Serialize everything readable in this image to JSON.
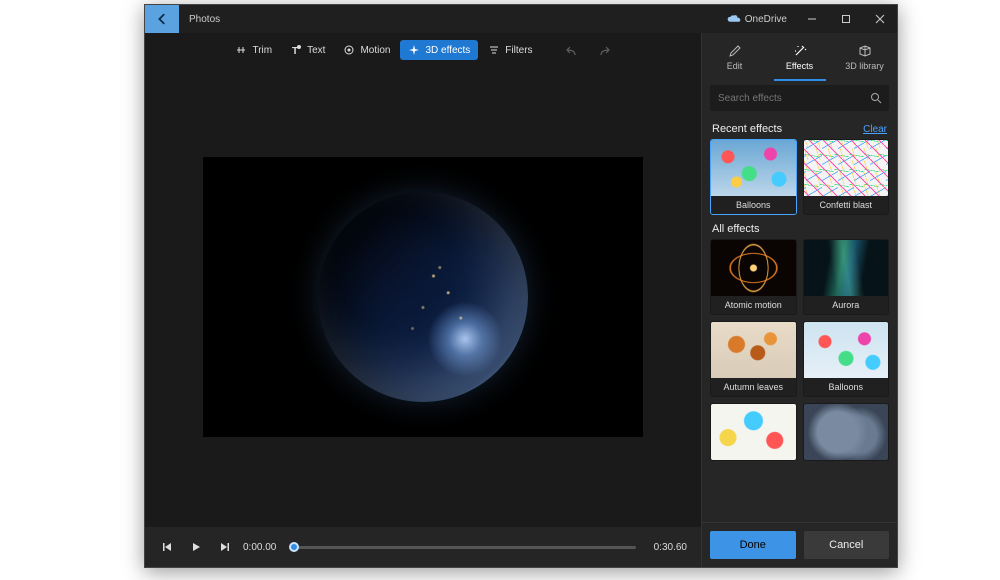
{
  "window": {
    "app_title": "Photos",
    "onedrive_label": "OneDrive"
  },
  "toolbar": {
    "trim": "Trim",
    "text": "Text",
    "motion": "Motion",
    "effects3d": "3D effects",
    "filters": "Filters"
  },
  "playback": {
    "current_time": "0:00.00",
    "total_time": "0:30.60"
  },
  "side": {
    "tabs": {
      "edit": "Edit",
      "effects": "Effects",
      "library3d": "3D library"
    },
    "search_placeholder": "Search effects",
    "recent_header": "Recent effects",
    "clear_link": "Clear",
    "all_header": "All effects",
    "recent": [
      {
        "label": "Balloons",
        "cls": "fx-balloons",
        "selected": true
      },
      {
        "label": "Confetti blast",
        "cls": "fx-confetti",
        "selected": false
      }
    ],
    "all": [
      {
        "label": "Atomic motion",
        "cls": "fx-atomic"
      },
      {
        "label": "Aurora",
        "cls": "fx-aurora"
      },
      {
        "label": "Autumn leaves",
        "cls": "fx-leaves"
      },
      {
        "label": "Balloons",
        "cls": "fx-balloons2"
      },
      {
        "label": "",
        "cls": "fx-balloons3"
      },
      {
        "label": "",
        "cls": "fx-cloud"
      }
    ],
    "done": "Done",
    "cancel": "Cancel"
  }
}
